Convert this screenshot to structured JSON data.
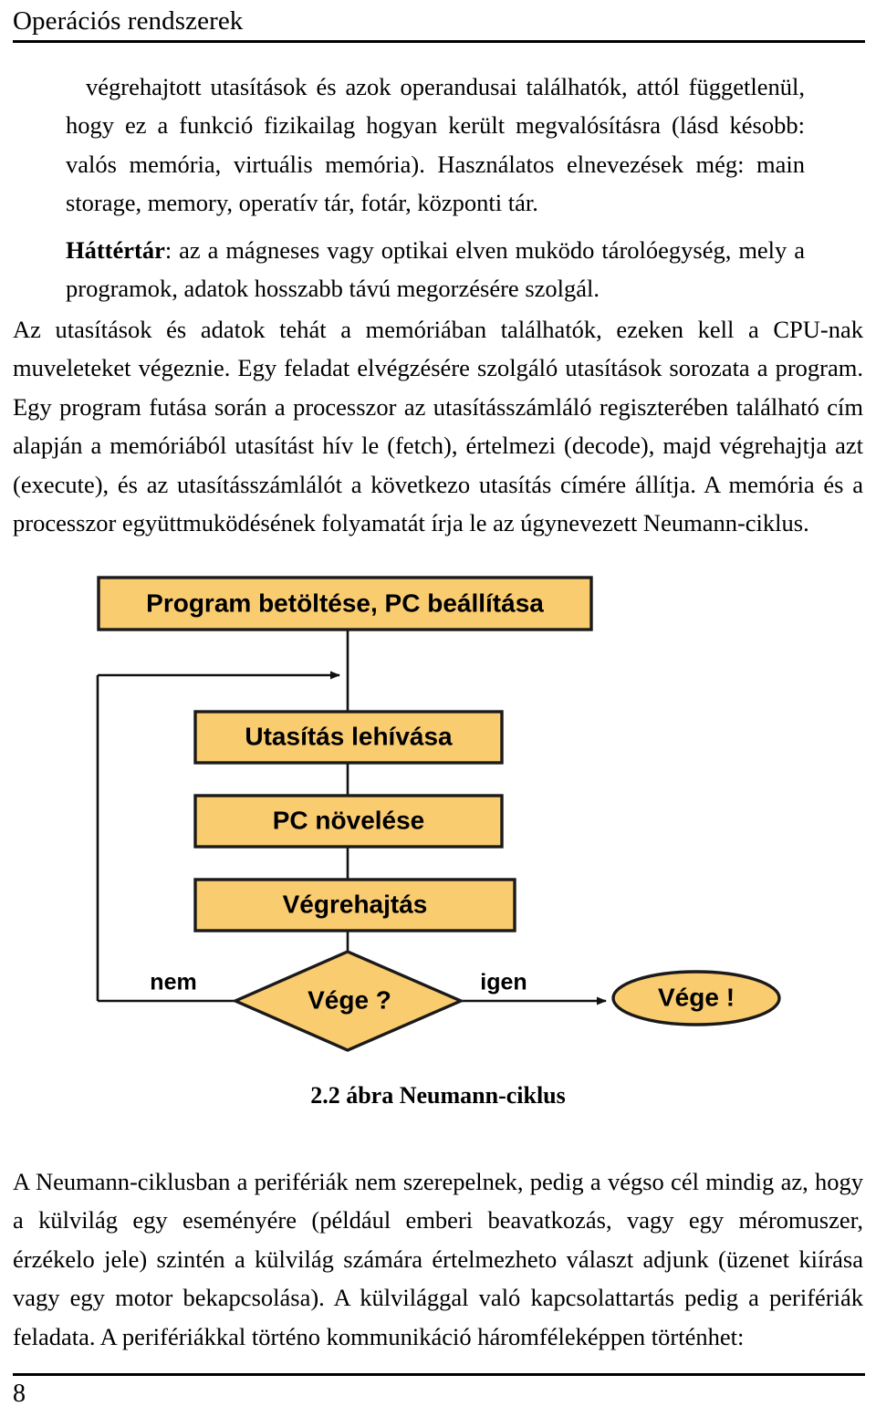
{
  "header": {
    "title": "Operációs rendszerek"
  },
  "content": {
    "paragraph_memoria": "végrehajtott utasítások és azok operandusai találhatók, attól függetlenül, hogy ez a funkció fizikailag hogyan került megvalósításra (lásd késobb: valós memória, virtuális memória). Használatos elnevezések még: main storage, memory, operatív tár, fotár, központi tár.",
    "paragraph_hattertar_lead": "Háttértár",
    "paragraph_hattertar_rest": ": az a mágneses vagy optikai elven muködo tárolóegység, mely a programok, adatok hosszabb távú megorzésére szolgál.",
    "paragraph_utasitasok": "Az utasítások és adatok tehát a memóriában találhatók, ezeken kell a CPU-nak muveleteket végeznie. Egy feladat elvégzésére szolgáló utasítások sorozata a program. Egy program futása során a processzor az utasításszámláló regiszterében található cím alapján a memóriából utasítást hív le (fetch), értelmezi (decode), majd végrehajtja azt (execute), és az utasításszámlálót a következo utasítás címére állítja. A memória és a processzor együttmuködésének folyamatát írja le az úgynevezett Neumann-ciklus.",
    "paragraph_periferiak": "A Neumann-ciklusban a perifériák nem szerepelnek, pedig a végso cél mindig az, hogy a külvilág egy eseményére (például emberi beavatkozás, vagy egy méromuszer, érzékelo jele) szintén a külvilág számára értelmezheto választ adjunk (üzenet kiírása vagy egy motor bekapcsolása). A külvilággal való kapcsolattartás pedig a perifériák feladata. A perifériákkal történo kommunikáció háromféleképpen történhet:"
  },
  "figure": {
    "caption": "2.2 ábra Neumann-ciklus",
    "fill_color": "#FACC70",
    "stroke_color": "#1a1a1a",
    "nodes": {
      "load_program": "Program betöltése, PC beállítása",
      "fetch": "Utasítás lehívása",
      "increment_pc": "PC növelése",
      "execute": "Végrehajtás",
      "decision": "Vége ?",
      "end": "Vége !"
    },
    "edge_labels": {
      "no": "nem",
      "yes": "igen"
    }
  },
  "footer": {
    "page_number": "8"
  }
}
